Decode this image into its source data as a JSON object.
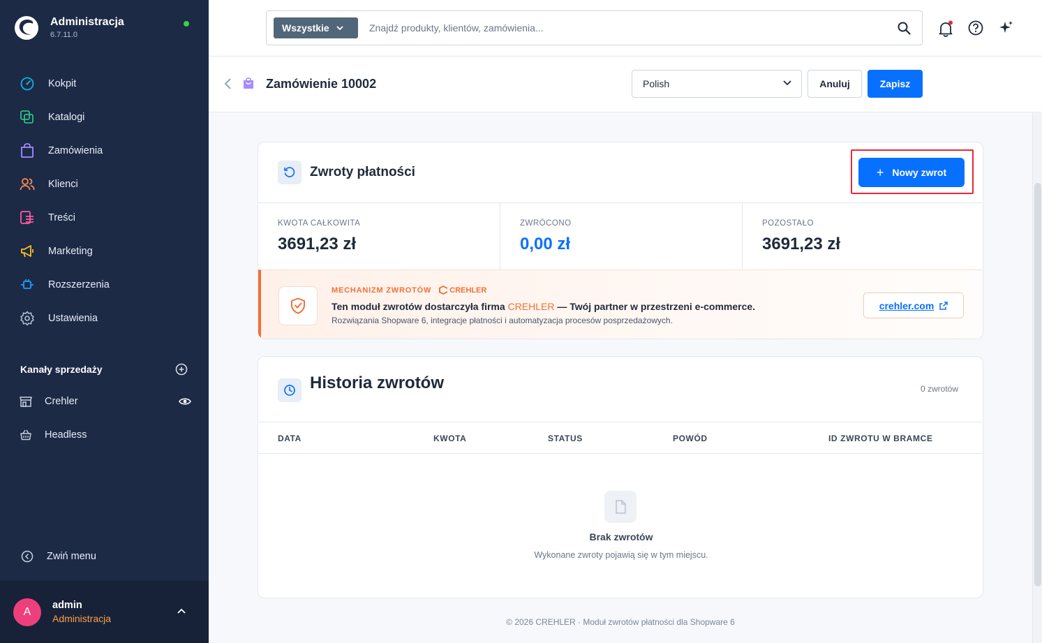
{
  "app": {
    "title": "Administracja",
    "version": "6.7.11.0"
  },
  "nav": {
    "items": [
      {
        "label": "Kokpit",
        "icon": "dashboard-icon",
        "color": "#0fb3e0"
      },
      {
        "label": "Katalogi",
        "icon": "catalog-icon",
        "color": "#29c281"
      },
      {
        "label": "Zamówienia",
        "icon": "shopping-bag-icon",
        "color": "#a58cff"
      },
      {
        "label": "Klienci",
        "icon": "customers-icon",
        "color": "#ff8a4d"
      },
      {
        "label": "Treści",
        "icon": "content-icon",
        "color": "#ff5aa0"
      },
      {
        "label": "Marketing",
        "icon": "megaphone-icon",
        "color": "#ffc21a"
      },
      {
        "label": "Rozszerzenia",
        "icon": "plugin-icon",
        "color": "#1a9fff"
      },
      {
        "label": "Ustawienia",
        "icon": "gear-icon",
        "color": "#b7c1d3"
      }
    ],
    "channels_title": "Kanały sprzedaży",
    "channels": [
      {
        "label": "Crehler",
        "icon": "storefront-icon"
      },
      {
        "label": "Headless",
        "icon": "basket-icon"
      }
    ],
    "collapse_label": "Zwiń menu"
  },
  "user": {
    "initial": "A",
    "name": "admin",
    "role": "Administracja"
  },
  "search": {
    "type_label": "Wszystkie",
    "placeholder": "Znajdź produkty, klientów, zamówienia..."
  },
  "page": {
    "title": "Zamówienie 10002",
    "language": "Polish",
    "cancel_label": "Anuluj",
    "save_label": "Zapisz"
  },
  "refunds": {
    "title": "Zwroty płatności",
    "new_button_label": "Nowy zwrot",
    "stats": [
      {
        "label": "KWOTA CAŁKOWITA",
        "value": "3691,23 zł"
      },
      {
        "label": "ZWRÓCONO",
        "value": "0,00 zł"
      },
      {
        "label": "POZOSTAŁO",
        "value": "3691,23 zł"
      }
    ]
  },
  "promo": {
    "kicker": "MECHANIZM ZWROTÓW",
    "brand_logo_text": "CREHLER",
    "text_before": "Ten moduł zwrotów dostarczyła firma ",
    "text_brand": "CREHLER",
    "text_after": " — Twój partner w przestrzeni e-commerce.",
    "subtext": "Rozwiązania Shopware 6, integracje płatności i automatyzacja procesów posprzedażowych.",
    "link_label": "crehler.com"
  },
  "history": {
    "title": "Historia zwrotów",
    "count_label": "0 zwrotów",
    "columns": [
      "DATA",
      "KWOTA",
      "STATUS",
      "POWÓD",
      "ID ZWROTU W BRAMCE"
    ],
    "empty_title": "Brak zwrotów",
    "empty_subtitle": "Wykonane zwroty pojawią się w tym miejscu."
  },
  "footer": {
    "text": "© 2026 CREHLER · Moduł zwrotów płatności dla Shopware 6"
  },
  "colors": {
    "sidebar_bg": "#1c2a46",
    "primary": "#0870ff",
    "accent_orange": "#f46f34",
    "highlight_red": "#e8283a"
  }
}
